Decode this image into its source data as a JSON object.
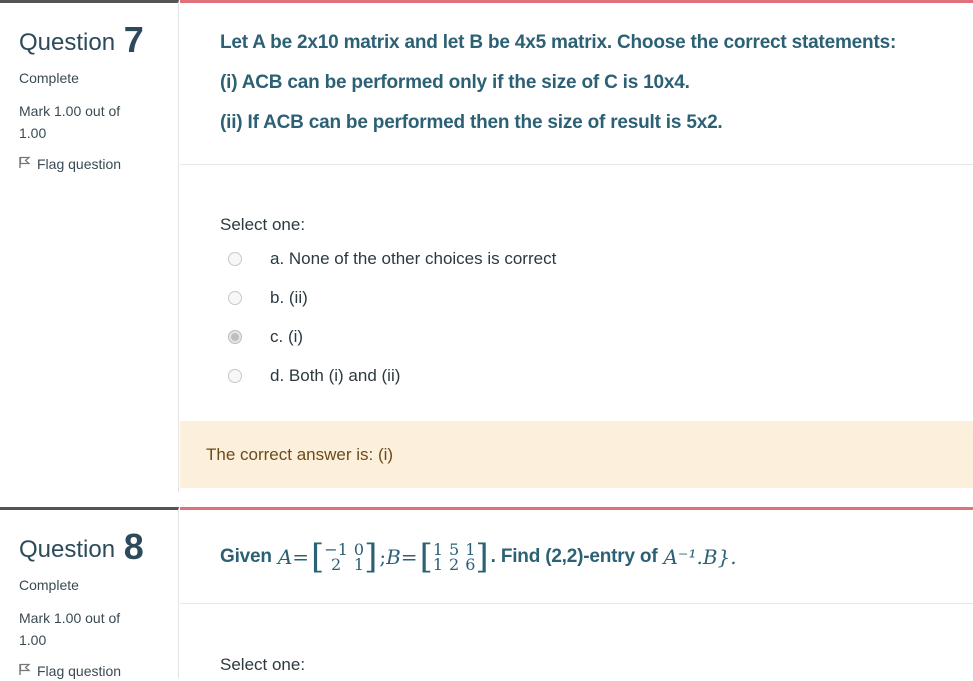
{
  "q7": {
    "label": "Question",
    "number": "7",
    "state": "Complete",
    "grade": "Mark 1.00 out of 1.00",
    "flag": "Flag question",
    "text": [
      "Let A be 2x10 matrix and let B be 4x5 matrix. Choose the correct statements:",
      "(i) ACB can be performed only if the size of C is 10x4.",
      "(ii) If ACB can be performed then the size of result is 5x2."
    ],
    "prompt": "Select one:",
    "options": [
      {
        "label": "a. None of the other choices is correct",
        "checked": false
      },
      {
        "label": "b. (ii)",
        "checked": false
      },
      {
        "label": "c. (i)",
        "checked": true
      },
      {
        "label": "d. Both (i) and (ii)",
        "checked": false
      }
    ],
    "feedback": "The correct answer is: (i)"
  },
  "q8": {
    "label": "Question",
    "number": "8",
    "state": "Complete",
    "grade": "Mark 1.00 out of 1.00",
    "flag": "Flag question",
    "given": "Given",
    "A_label": "A",
    "A": [
      [
        "−1",
        "0"
      ],
      [
        "2",
        "1"
      ]
    ],
    "sep": ";",
    "B_label": "B",
    "B": [
      [
        "1",
        "5",
        "1"
      ],
      [
        "1",
        "2",
        "6"
      ]
    ],
    "find": ". Find (2,2)-entry of",
    "expr": "A⁻¹.B}.",
    "prompt": "Select one:"
  },
  "colors": {
    "accent": "#e0707a",
    "question_text": "#2c6175",
    "feedback_bg": "#fcefdc"
  }
}
